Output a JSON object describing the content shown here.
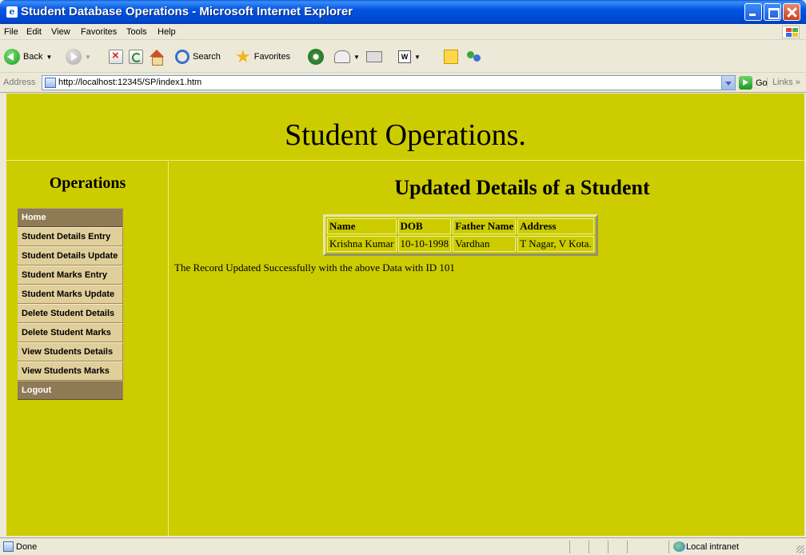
{
  "window": {
    "title": "Student Database Operations - Microsoft Internet Explorer"
  },
  "menubar": {
    "items": [
      "File",
      "Edit",
      "View",
      "Favorites",
      "Tools",
      "Help"
    ]
  },
  "toolbar": {
    "back_label": "Back",
    "search_label": "Search",
    "favorites_label": "Favorites",
    "icons": [
      "back-icon",
      "forward-icon",
      "stop-icon",
      "refresh-icon",
      "home-icon",
      "search-icon",
      "favorites-star-icon",
      "media-icon",
      "mail-icon",
      "print-icon",
      "word-icon",
      "note-icon",
      "messenger-icon"
    ]
  },
  "addressbar": {
    "label": "Address",
    "url": "http://localhost:12345/SP/index1.htm",
    "go_label": "Go",
    "links_label": "Links"
  },
  "page": {
    "header_title": "Student Operations.",
    "background_color": "#cccc00",
    "sidebar": {
      "title": "Operations",
      "items": [
        {
          "label": "Home",
          "style": "dark"
        },
        {
          "label": "Student Details Entry",
          "style": "light"
        },
        {
          "label": "Student Details Update",
          "style": "light"
        },
        {
          "label": "Student Marks Entry",
          "style": "light"
        },
        {
          "label": "Student Marks Update",
          "style": "light"
        },
        {
          "label": "Delete Student Details",
          "style": "light"
        },
        {
          "label": "Delete Student Marks",
          "style": "light"
        },
        {
          "label": "View Students Details",
          "style": "light"
        },
        {
          "label": "View Students Marks",
          "style": "light"
        },
        {
          "label": "Logout",
          "style": "dark"
        }
      ]
    },
    "main": {
      "heading": "Updated Details of a Student",
      "table": {
        "headers": [
          "Name",
          "DOB",
          "Father Name",
          "Address"
        ],
        "rows": [
          [
            "Krishna Kumar",
            "10-10-1998",
            "Vardhan",
            "T Nagar, V Kota."
          ]
        ]
      },
      "status_message": "The Record Updated Successfully with the above Data with ID 101"
    }
  },
  "statusbar": {
    "text": "Done",
    "zone": "Local intranet"
  }
}
